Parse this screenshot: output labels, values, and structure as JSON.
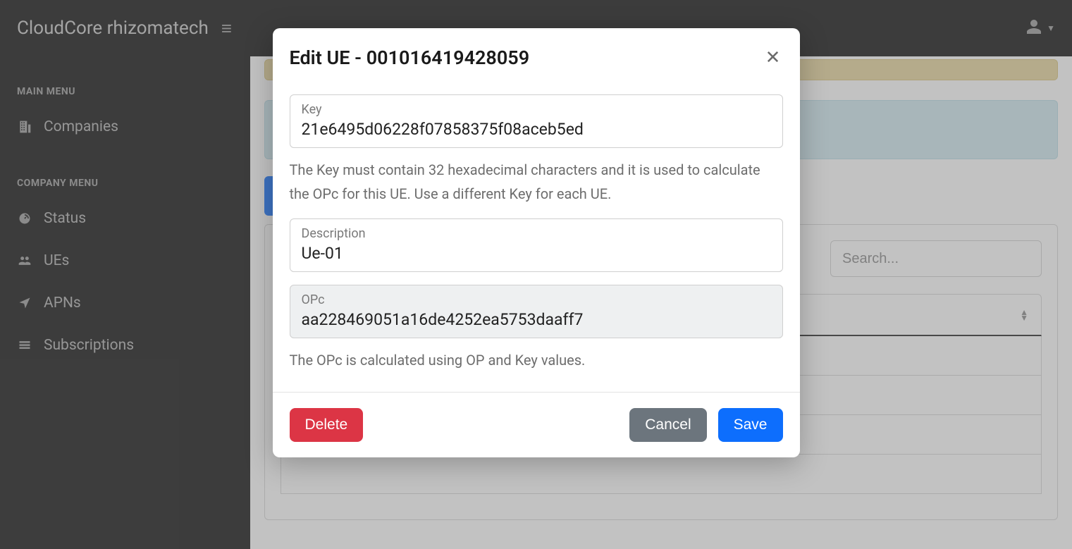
{
  "brand": "CloudCore rhizomatech",
  "sidebar": {
    "main_heading": "MAIN MENU",
    "company_heading": "COMPANY MENU",
    "companies": "Companies",
    "status": "Status",
    "ues": "UEs",
    "apns": "APNs",
    "subscriptions": "Subscriptions"
  },
  "main": {
    "search_placeholder": "Search..."
  },
  "modal": {
    "title": "Edit UE - 001016419428059",
    "key_label": "Key",
    "key_value": "21e6495d06228f07858375f08aceb5ed",
    "key_help": "The Key must contain 32 hexadecimal characters and it is used to calculate the OPc for this UE. Use a different Key for each UE.",
    "desc_label": "Description",
    "desc_value": "Ue-01",
    "opc_label": "OPc",
    "opc_value": "aa228469051a16de4252ea5753daaff7",
    "opc_help": "The OPc is calculated using OP and Key values.",
    "delete": "Delete",
    "cancel": "Cancel",
    "save": "Save"
  }
}
